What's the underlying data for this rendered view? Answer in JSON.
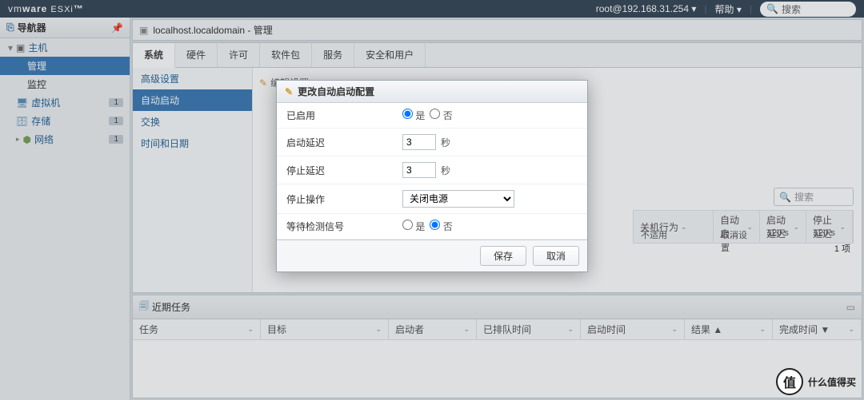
{
  "topbar": {
    "logo_prefix": "vm",
    "logo_main": "ware",
    "logo_suffix": " ESXi",
    "user": "root@192.168.31.254",
    "help": "帮助",
    "search": "搜索"
  },
  "sidebar": {
    "title": "导航器",
    "host": "主机",
    "manage": "管理",
    "monitor": "监控",
    "vm": "虚拟机",
    "storage": "存储",
    "network": "网络",
    "badge": "1"
  },
  "breadcrumb": {
    "host": "localhost.localdomain",
    "page": "管理"
  },
  "tabs": {
    "system": "系统",
    "hardware": "硬件",
    "license": "许可",
    "packages": "软件包",
    "services": "服务",
    "security": "安全和用户"
  },
  "subnav": {
    "advanced": "高级设置",
    "autostart": "自动启动",
    "swap": "交换",
    "datetime": "时间和日期"
  },
  "toolbar": {
    "edit": "编辑设置"
  },
  "innerSearch": {
    "placeholder": "搜索"
  },
  "gridHead": {
    "shutdown": "关机行为",
    "autostart": "自动启...",
    "startdelay": "启动延迟",
    "stopdelay": "停止延迟"
  },
  "gridRow": {
    "shutdown": "不适用",
    "autostart": "取消设置",
    "startdelay": "120 s",
    "stopdelay": "120 s"
  },
  "gridFooter": "1 项",
  "tasks": {
    "title": "近期任务",
    "task": "任务",
    "target": "目标",
    "initiator": "启动者",
    "queued": "已排队时间",
    "start": "启动时间",
    "result": "结果 ▲",
    "completed": "完成时间 ▼"
  },
  "dialog": {
    "title": "更改自动启动配置",
    "enabled": "已启用",
    "yes": "是",
    "no": "否",
    "startDelay": "启动延迟",
    "startDelayVal": "3",
    "sec": "秒",
    "stopDelay": "停止延迟",
    "stopDelayVal": "3",
    "stopAction": "停止操作",
    "stopActionVal": "关闭电源",
    "waitHeartbeat": "等待检测信号",
    "save": "保存",
    "cancel": "取消"
  },
  "watermark": "什么值得买",
  "watermarkIcon": "值"
}
